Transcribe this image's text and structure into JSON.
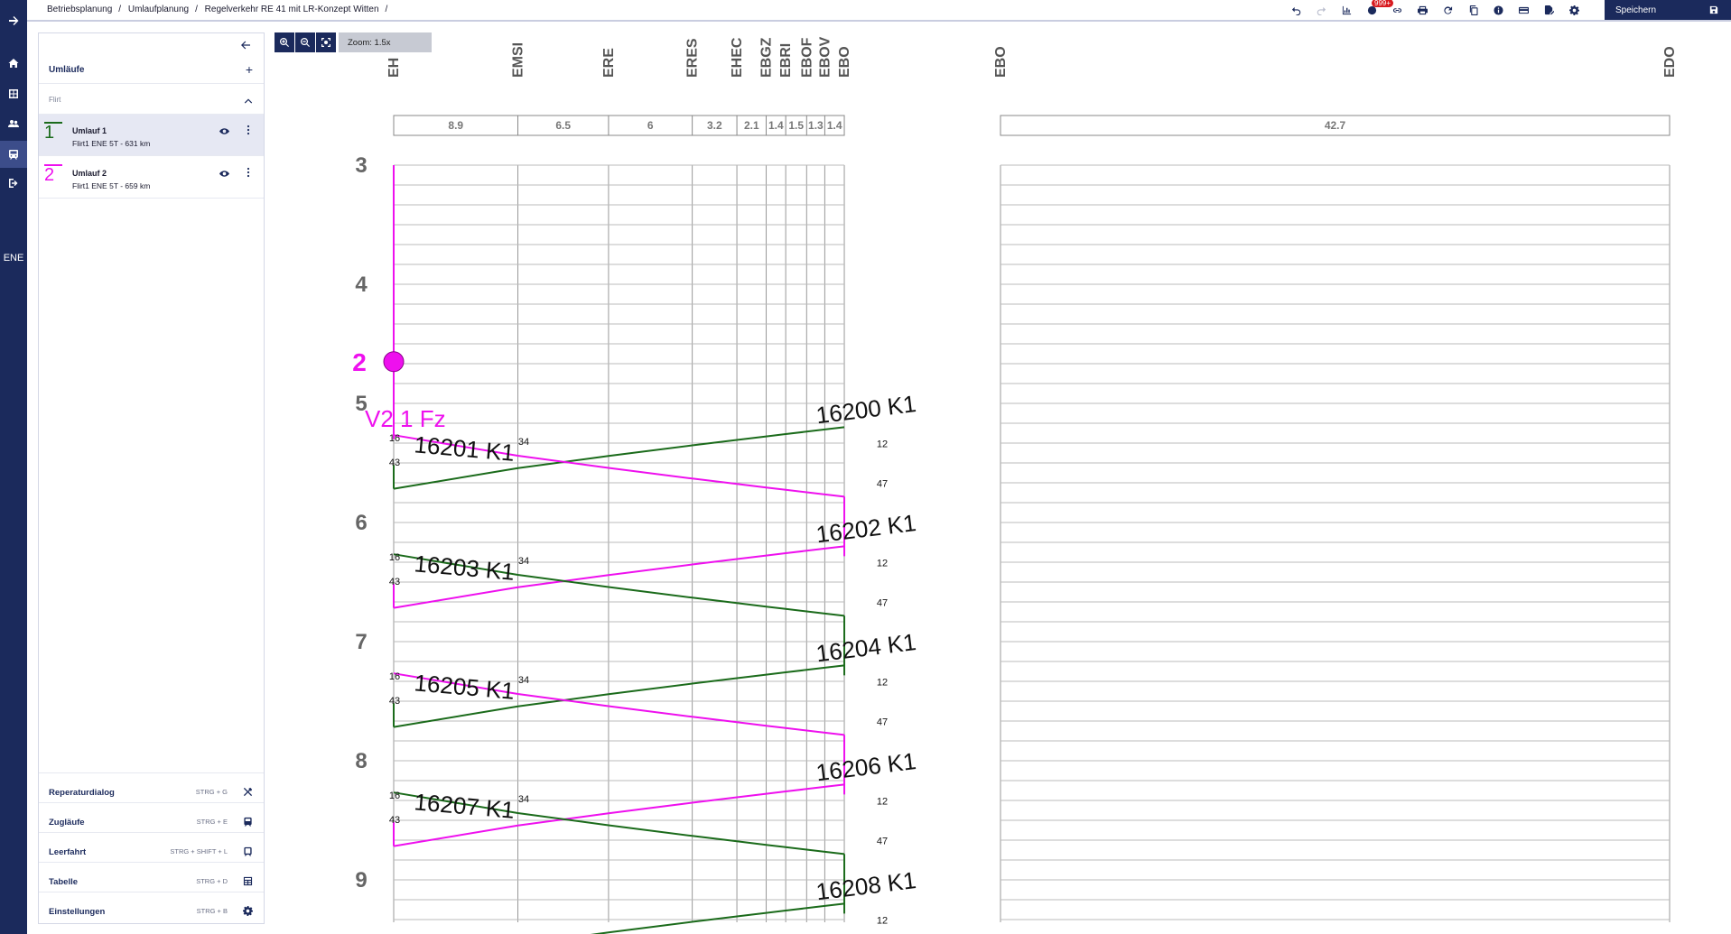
{
  "breadcrumb": [
    "Betriebsplanung",
    "Umlaufplanung",
    "Regelverkehr RE 41 mit LR-Konzept Witten"
  ],
  "rail": {
    "label": "ENE"
  },
  "toolbar": {
    "badge": "999+",
    "save_label": "Speichern"
  },
  "sidebar": {
    "header": "Umläufe",
    "group": "Flirt",
    "umlaeufe": [
      {
        "number": "1",
        "name": "Umlauf 1",
        "subtitle": "Flirt1 ENE 5T - 631 km",
        "color": "#1b6b1b"
      },
      {
        "number": "2",
        "name": "Umlauf 2",
        "subtitle": "Flirt1 ENE 5T - 659 km",
        "color": "#ee10ee"
      }
    ],
    "shortcuts": [
      {
        "name": "Reperaturdialog",
        "key": "STRG + G",
        "icon": "tools-icon"
      },
      {
        "name": "Zugläufe",
        "key": "STRG + E",
        "icon": "train-icon"
      },
      {
        "name": "Leerfahrt",
        "key": "STRG + SHIFT + L",
        "icon": "train-empty-icon"
      },
      {
        "name": "Tabelle",
        "key": "STRG + D",
        "icon": "table-icon"
      },
      {
        "name": "Einstellungen",
        "key": "STRG + B",
        "icon": "gear-icon"
      }
    ]
  },
  "chart_toolbar": {
    "zoom_label": "Zoom: 1.5x"
  },
  "colors": {
    "umlauf1": "#1b6b1b",
    "umlauf2": "#ee10ee",
    "accent": "#1b2a5c"
  },
  "chart_data": {
    "type": "diagram",
    "stations": [
      "EH",
      "EMSI",
      "ERE",
      "ERES",
      "EHEC",
      "EBGZ",
      "EBRI",
      "EBOF",
      "EBOV",
      "EBO",
      "EBO",
      "EDO"
    ],
    "station_visible_labels": [
      "EH",
      "EMSI",
      "ERE",
      "ERES",
      "EHEC",
      "EBGZ",
      "EBRI",
      "EBOF",
      "EBOV",
      "EBO",
      "EBO",
      "EDO"
    ],
    "distances_km": [
      8.9,
      6.5,
      6,
      3.2,
      2.1,
      1.4,
      1.5,
      1.3,
      1.4,
      42.7
    ],
    "hour_labels": [
      3,
      4,
      5,
      6,
      7,
      8,
      9
    ],
    "marker": {
      "label": "2",
      "hour": 4.65
    },
    "annotation": "V2 1 Fz",
    "trains": [
      {
        "label": "16200 K1",
        "minute_start": "12",
        "minute_end": "47"
      },
      {
        "label": "16201 K1",
        "minute_start": "16",
        "minute_end": "43",
        "mid": "34"
      },
      {
        "label": "16202 K1",
        "minute_start": "12",
        "minute_end": "47"
      },
      {
        "label": "16203 K1",
        "minute_start": "16",
        "minute_end": "43",
        "mid": "34"
      },
      {
        "label": "16204 K1",
        "minute_start": "12",
        "minute_end": "47"
      },
      {
        "label": "16205 K1",
        "minute_start": "16",
        "minute_end": "43",
        "mid": "34"
      },
      {
        "label": "16206 K1",
        "minute_start": "12",
        "minute_end": "47"
      },
      {
        "label": "16207 K1",
        "minute_start": "16",
        "minute_end": "43",
        "mid": "34"
      },
      {
        "label": "16208 K1",
        "minute_start": "12"
      }
    ]
  }
}
